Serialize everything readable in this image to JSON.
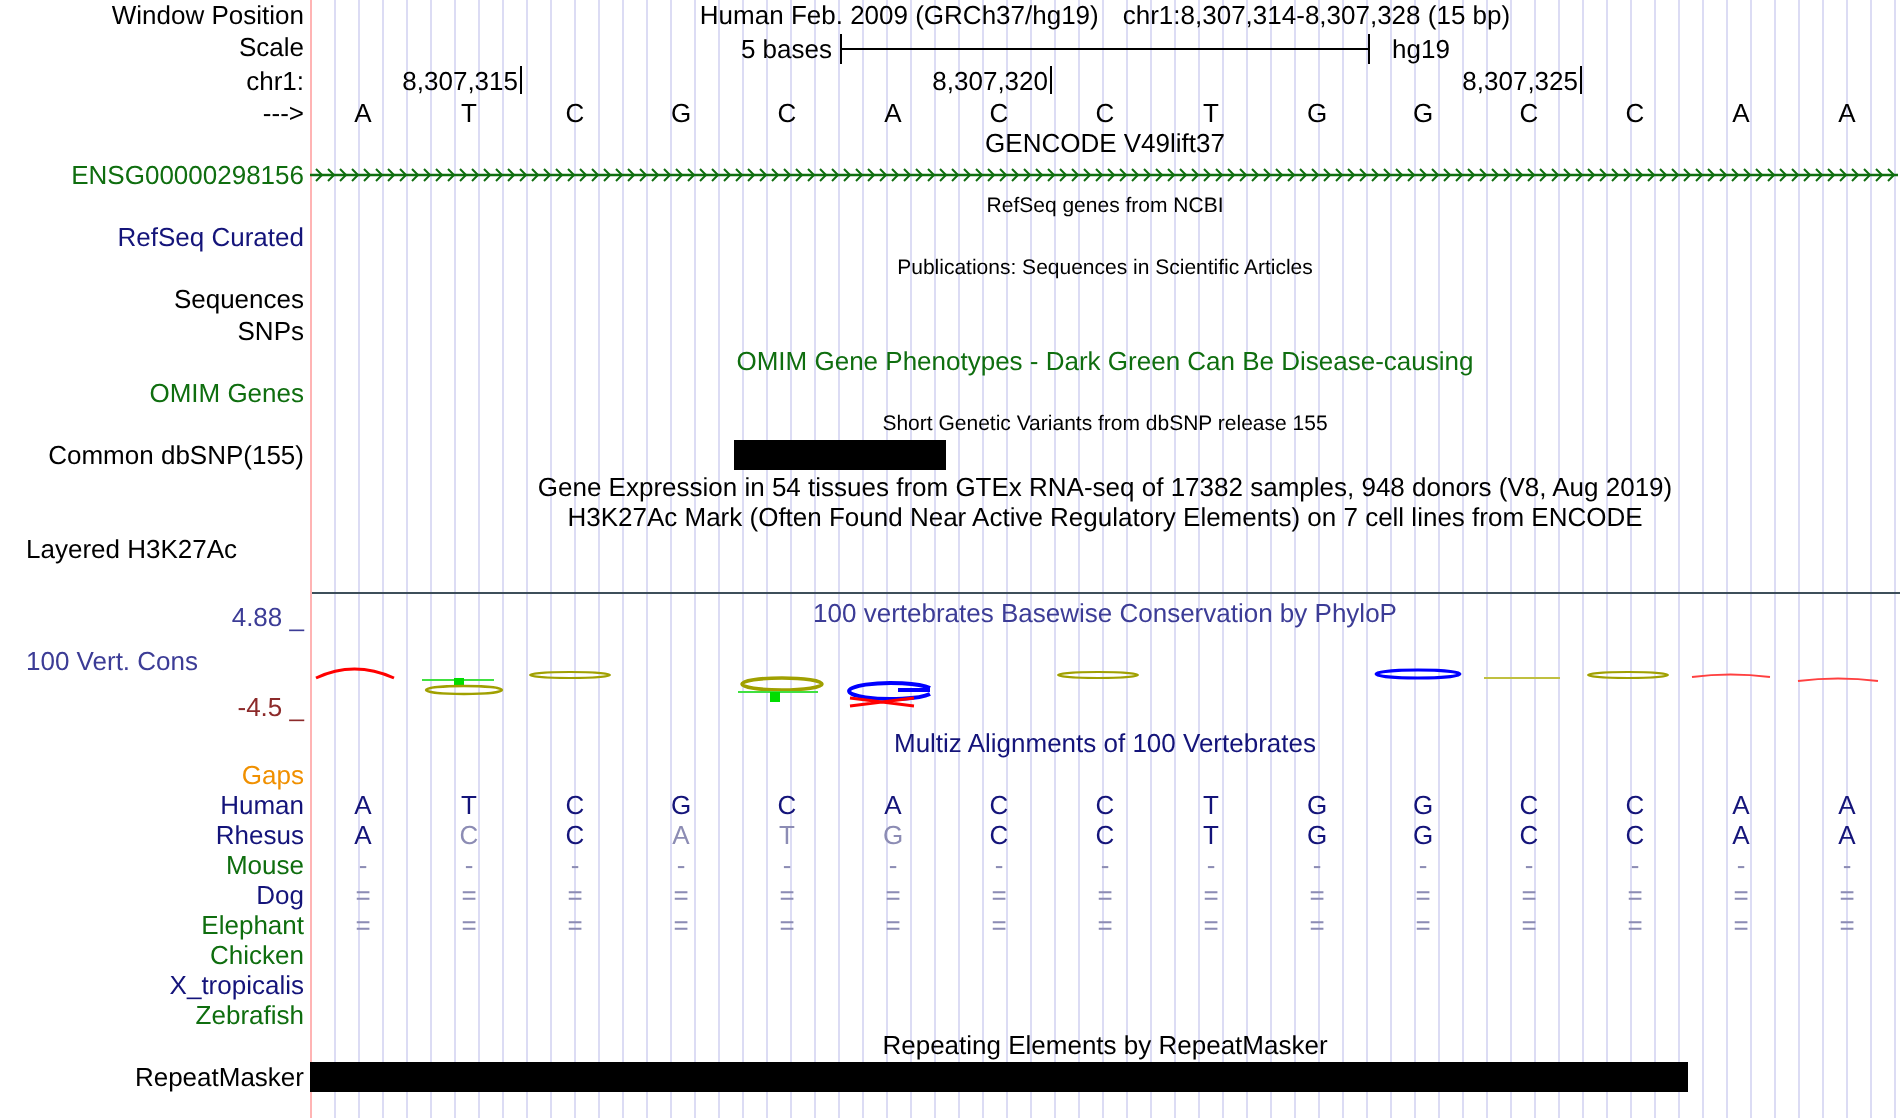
{
  "rows": [
    {
      "kind": "position",
      "label": {
        "text": "Window Position",
        "color": "#000000"
      },
      "assembly": "Human Feb. 2009 (GRCh37/hg19)",
      "range": "chr1:8,307,314-8,307,328 (15 bp)"
    },
    {
      "kind": "scale",
      "label": {
        "text": "Scale",
        "color": "#000000"
      },
      "length": "5 bases",
      "db": "hg19"
    },
    {
      "kind": "ruler",
      "label": {
        "text": "chr1:",
        "color": "#000000"
      },
      "ticks": [
        "8,307,315",
        "8,307,320",
        "8,307,325"
      ]
    },
    {
      "kind": "bases",
      "label": {
        "text": "--->",
        "color": "#000000"
      },
      "bases": [
        "A",
        "T",
        "C",
        "G",
        "C",
        "A",
        "C",
        "C",
        "T",
        "G",
        "G",
        "C",
        "C",
        "A",
        "A"
      ]
    },
    {
      "kind": "title",
      "title": {
        "text": "GENCODE V49lift37",
        "color": "#000000"
      }
    },
    {
      "kind": "gene",
      "label": {
        "text": "ENSG00000298156",
        "color": "#0f6e0f"
      },
      "color": "#0f6e0f"
    },
    {
      "kind": "caption",
      "title": {
        "text": "RefSeq genes from NCBI",
        "color": "#000000"
      }
    },
    {
      "kind": "label",
      "label": {
        "text": "RefSeq Curated",
        "color": "#14147a"
      }
    },
    {
      "kind": "caption",
      "title": {
        "text": "Publications: Sequences in Scientific Articles",
        "color": "#000000"
      }
    },
    {
      "kind": "label",
      "label": {
        "text": "Sequences",
        "color": "#000000"
      }
    },
    {
      "kind": "label",
      "label": {
        "text": "SNPs",
        "color": "#000000"
      }
    },
    {
      "kind": "title",
      "title": {
        "text": "OMIM Gene Phenotypes - Dark Green Can Be Disease-causing",
        "color": "#0f6e0f"
      }
    },
    {
      "kind": "label",
      "label": {
        "text": "OMIM Genes",
        "color": "#0f6e0f"
      }
    },
    {
      "kind": "caption",
      "title": {
        "text": "Short Genetic Variants from dbSNP release 155",
        "color": "#000000"
      }
    },
    {
      "kind": "bar",
      "label": {
        "text": "Common dbSNP(155)",
        "color": "#000000"
      },
      "covered": [
        false,
        false,
        false,
        false,
        true,
        true,
        false,
        false,
        false,
        false,
        false,
        false,
        false,
        false,
        false
      ]
    },
    {
      "kind": "title",
      "title": {
        "text": "Gene Expression in 54 tissues from GTEx RNA-seq of 17382 samples, 948 donors (V8, Aug 2019)",
        "color": "#000000"
      }
    },
    {
      "kind": "title",
      "title": {
        "text": "H3K27Ac Mark (Often Found Near Active Regulatory Elements) on 7 cell lines from ENCODE",
        "color": "#000000"
      }
    },
    {
      "kind": "layered",
      "label": {
        "text": "Layered H3K27Ac",
        "color": "#000000"
      }
    },
    {
      "kind": "divider"
    },
    {
      "kind": "conservation",
      "title": {
        "text": "100 vertebrates Basewise Conservation by PhyloP",
        "color": "#3c3c96"
      },
      "max": {
        "text": "4.88 _",
        "color": "#3c3c96"
      },
      "label": {
        "text": "100 Vert. Cons",
        "color": "#3c3c96"
      },
      "min": {
        "text": "-4.5 _",
        "color": "#8c2a2a"
      }
    },
    {
      "kind": "title",
      "title": {
        "text": "Multiz Alignments of 100 Vertebrates",
        "color": "#14147a"
      }
    },
    {
      "kind": "label",
      "label": {
        "text": "Gaps",
        "color": "#f09000"
      }
    },
    {
      "kind": "species",
      "label": {
        "text": "Human",
        "color": "#14147a"
      },
      "cells": [
        {
          "text": "A",
          "muted": false
        },
        {
          "text": "T",
          "muted": false
        },
        {
          "text": "C",
          "muted": false
        },
        {
          "text": "G",
          "muted": false
        },
        {
          "text": "C",
          "muted": false
        },
        {
          "text": "A",
          "muted": false
        },
        {
          "text": "C",
          "muted": false
        },
        {
          "text": "C",
          "muted": false
        },
        {
          "text": "T",
          "muted": false
        },
        {
          "text": "G",
          "muted": false
        },
        {
          "text": "G",
          "muted": false
        },
        {
          "text": "C",
          "muted": false
        },
        {
          "text": "C",
          "muted": false
        },
        {
          "text": "A",
          "muted": false
        },
        {
          "text": "A",
          "muted": false
        }
      ]
    },
    {
      "kind": "species",
      "label": {
        "text": "Rhesus",
        "color": "#14147a"
      },
      "cells": [
        {
          "text": "A",
          "muted": false
        },
        {
          "text": "C",
          "muted": true
        },
        {
          "text": "C",
          "muted": false
        },
        {
          "text": "A",
          "muted": true
        },
        {
          "text": "T",
          "muted": true
        },
        {
          "text": "G",
          "muted": true
        },
        {
          "text": "C",
          "muted": false
        },
        {
          "text": "C",
          "muted": false
        },
        {
          "text": "T",
          "muted": false
        },
        {
          "text": "G",
          "muted": false
        },
        {
          "text": "G",
          "muted": false
        },
        {
          "text": "C",
          "muted": false
        },
        {
          "text": "C",
          "muted": false
        },
        {
          "text": "A",
          "muted": false
        },
        {
          "text": "A",
          "muted": false
        }
      ]
    },
    {
      "kind": "species",
      "label": {
        "text": "Mouse",
        "color": "#0f6e0f"
      },
      "cells": [
        {
          "text": "-",
          "muted": true
        },
        {
          "text": "-",
          "muted": true
        },
        {
          "text": "-",
          "muted": true
        },
        {
          "text": "-",
          "muted": true
        },
        {
          "text": "-",
          "muted": true
        },
        {
          "text": "-",
          "muted": true
        },
        {
          "text": "-",
          "muted": true
        },
        {
          "text": "-",
          "muted": true
        },
        {
          "text": "-",
          "muted": true
        },
        {
          "text": "-",
          "muted": true
        },
        {
          "text": "-",
          "muted": true
        },
        {
          "text": "-",
          "muted": true
        },
        {
          "text": "-",
          "muted": true
        },
        {
          "text": "-",
          "muted": true
        },
        {
          "text": "-",
          "muted": true
        }
      ]
    },
    {
      "kind": "species",
      "label": {
        "text": "Dog",
        "color": "#14147a"
      },
      "cells": [
        {
          "text": "=",
          "muted": true
        },
        {
          "text": "=",
          "muted": true
        },
        {
          "text": "=",
          "muted": true
        },
        {
          "text": "=",
          "muted": true
        },
        {
          "text": "=",
          "muted": true
        },
        {
          "text": "=",
          "muted": true
        },
        {
          "text": "=",
          "muted": true
        },
        {
          "text": "=",
          "muted": true
        },
        {
          "text": "=",
          "muted": true
        },
        {
          "text": "=",
          "muted": true
        },
        {
          "text": "=",
          "muted": true
        },
        {
          "text": "=",
          "muted": true
        },
        {
          "text": "=",
          "muted": true
        },
        {
          "text": "=",
          "muted": true
        },
        {
          "text": "=",
          "muted": true
        }
      ]
    },
    {
      "kind": "species",
      "label": {
        "text": "Elephant",
        "color": "#0f6e0f"
      },
      "cells": [
        {
          "text": "=",
          "muted": true
        },
        {
          "text": "=",
          "muted": true
        },
        {
          "text": "=",
          "muted": true
        },
        {
          "text": "=",
          "muted": true
        },
        {
          "text": "=",
          "muted": true
        },
        {
          "text": "=",
          "muted": true
        },
        {
          "text": "=",
          "muted": true
        },
        {
          "text": "=",
          "muted": true
        },
        {
          "text": "=",
          "muted": true
        },
        {
          "text": "=",
          "muted": true
        },
        {
          "text": "=",
          "muted": true
        },
        {
          "text": "=",
          "muted": true
        },
        {
          "text": "=",
          "muted": true
        },
        {
          "text": "=",
          "muted": true
        },
        {
          "text": "=",
          "muted": true
        }
      ]
    },
    {
      "kind": "species",
      "label": {
        "text": "Chicken",
        "color": "#0f6e0f"
      }
    },
    {
      "kind": "species",
      "label": {
        "text": "X_tropicalis",
        "color": "#14147a"
      }
    },
    {
      "kind": "species",
      "label": {
        "text": "Zebrafish",
        "color": "#0f6e0f"
      }
    },
    {
      "kind": "title",
      "title": {
        "text": "Repeating Elements by RepeatMasker",
        "color": "#000000"
      }
    },
    {
      "kind": "bar",
      "label": {
        "text": "RepeatMasker",
        "color": "#000000"
      },
      "covered": [
        true,
        true,
        true,
        true,
        true,
        true,
        true,
        true,
        true,
        true,
        true,
        true,
        true,
        false,
        false
      ]
    }
  ]
}
